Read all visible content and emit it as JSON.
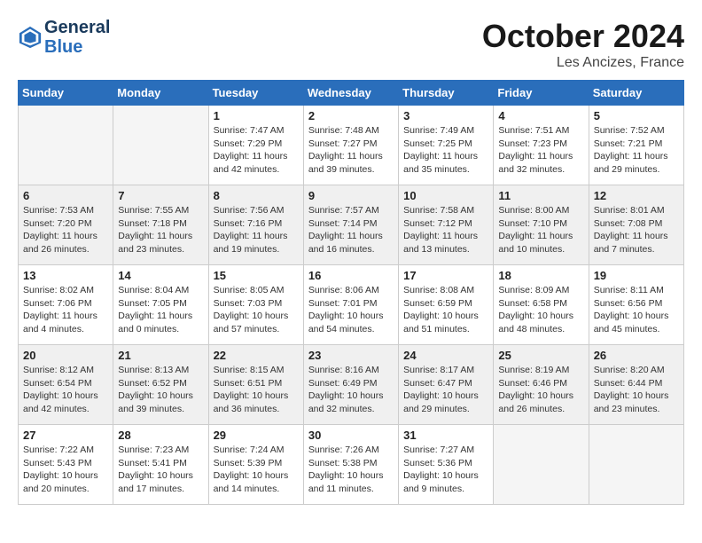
{
  "header": {
    "logo_line1": "General",
    "logo_line2": "Blue",
    "month": "October 2024",
    "location": "Les Ancizes, France"
  },
  "days_of_week": [
    "Sunday",
    "Monday",
    "Tuesday",
    "Wednesday",
    "Thursday",
    "Friday",
    "Saturday"
  ],
  "weeks": [
    [
      {
        "day": "",
        "info": ""
      },
      {
        "day": "",
        "info": ""
      },
      {
        "day": "1",
        "info": "Sunrise: 7:47 AM\nSunset: 7:29 PM\nDaylight: 11 hours and 42 minutes."
      },
      {
        "day": "2",
        "info": "Sunrise: 7:48 AM\nSunset: 7:27 PM\nDaylight: 11 hours and 39 minutes."
      },
      {
        "day": "3",
        "info": "Sunrise: 7:49 AM\nSunset: 7:25 PM\nDaylight: 11 hours and 35 minutes."
      },
      {
        "day": "4",
        "info": "Sunrise: 7:51 AM\nSunset: 7:23 PM\nDaylight: 11 hours and 32 minutes."
      },
      {
        "day": "5",
        "info": "Sunrise: 7:52 AM\nSunset: 7:21 PM\nDaylight: 11 hours and 29 minutes."
      }
    ],
    [
      {
        "day": "6",
        "info": "Sunrise: 7:53 AM\nSunset: 7:20 PM\nDaylight: 11 hours and 26 minutes."
      },
      {
        "day": "7",
        "info": "Sunrise: 7:55 AM\nSunset: 7:18 PM\nDaylight: 11 hours and 23 minutes."
      },
      {
        "day": "8",
        "info": "Sunrise: 7:56 AM\nSunset: 7:16 PM\nDaylight: 11 hours and 19 minutes."
      },
      {
        "day": "9",
        "info": "Sunrise: 7:57 AM\nSunset: 7:14 PM\nDaylight: 11 hours and 16 minutes."
      },
      {
        "day": "10",
        "info": "Sunrise: 7:58 AM\nSunset: 7:12 PM\nDaylight: 11 hours and 13 minutes."
      },
      {
        "day": "11",
        "info": "Sunrise: 8:00 AM\nSunset: 7:10 PM\nDaylight: 11 hours and 10 minutes."
      },
      {
        "day": "12",
        "info": "Sunrise: 8:01 AM\nSunset: 7:08 PM\nDaylight: 11 hours and 7 minutes."
      }
    ],
    [
      {
        "day": "13",
        "info": "Sunrise: 8:02 AM\nSunset: 7:06 PM\nDaylight: 11 hours and 4 minutes."
      },
      {
        "day": "14",
        "info": "Sunrise: 8:04 AM\nSunset: 7:05 PM\nDaylight: 11 hours and 0 minutes."
      },
      {
        "day": "15",
        "info": "Sunrise: 8:05 AM\nSunset: 7:03 PM\nDaylight: 10 hours and 57 minutes."
      },
      {
        "day": "16",
        "info": "Sunrise: 8:06 AM\nSunset: 7:01 PM\nDaylight: 10 hours and 54 minutes."
      },
      {
        "day": "17",
        "info": "Sunrise: 8:08 AM\nSunset: 6:59 PM\nDaylight: 10 hours and 51 minutes."
      },
      {
        "day": "18",
        "info": "Sunrise: 8:09 AM\nSunset: 6:58 PM\nDaylight: 10 hours and 48 minutes."
      },
      {
        "day": "19",
        "info": "Sunrise: 8:11 AM\nSunset: 6:56 PM\nDaylight: 10 hours and 45 minutes."
      }
    ],
    [
      {
        "day": "20",
        "info": "Sunrise: 8:12 AM\nSunset: 6:54 PM\nDaylight: 10 hours and 42 minutes."
      },
      {
        "day": "21",
        "info": "Sunrise: 8:13 AM\nSunset: 6:52 PM\nDaylight: 10 hours and 39 minutes."
      },
      {
        "day": "22",
        "info": "Sunrise: 8:15 AM\nSunset: 6:51 PM\nDaylight: 10 hours and 36 minutes."
      },
      {
        "day": "23",
        "info": "Sunrise: 8:16 AM\nSunset: 6:49 PM\nDaylight: 10 hours and 32 minutes."
      },
      {
        "day": "24",
        "info": "Sunrise: 8:17 AM\nSunset: 6:47 PM\nDaylight: 10 hours and 29 minutes."
      },
      {
        "day": "25",
        "info": "Sunrise: 8:19 AM\nSunset: 6:46 PM\nDaylight: 10 hours and 26 minutes."
      },
      {
        "day": "26",
        "info": "Sunrise: 8:20 AM\nSunset: 6:44 PM\nDaylight: 10 hours and 23 minutes."
      }
    ],
    [
      {
        "day": "27",
        "info": "Sunrise: 7:22 AM\nSunset: 5:43 PM\nDaylight: 10 hours and 20 minutes."
      },
      {
        "day": "28",
        "info": "Sunrise: 7:23 AM\nSunset: 5:41 PM\nDaylight: 10 hours and 17 minutes."
      },
      {
        "day": "29",
        "info": "Sunrise: 7:24 AM\nSunset: 5:39 PM\nDaylight: 10 hours and 14 minutes."
      },
      {
        "day": "30",
        "info": "Sunrise: 7:26 AM\nSunset: 5:38 PM\nDaylight: 10 hours and 11 minutes."
      },
      {
        "day": "31",
        "info": "Sunrise: 7:27 AM\nSunset: 5:36 PM\nDaylight: 10 hours and 9 minutes."
      },
      {
        "day": "",
        "info": ""
      },
      {
        "day": "",
        "info": ""
      }
    ]
  ]
}
